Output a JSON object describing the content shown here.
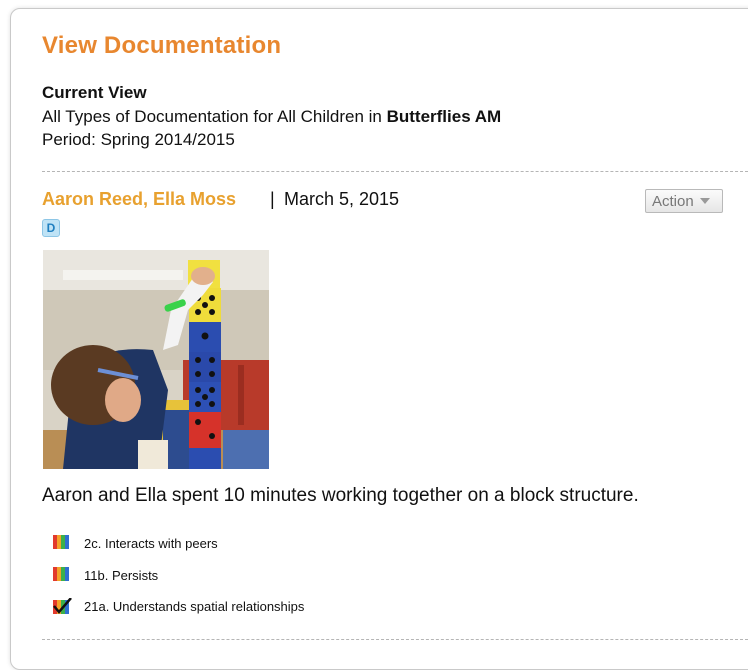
{
  "header": {
    "title": "View Documentation"
  },
  "current_view": {
    "heading": "Current View",
    "description_prefix": "All Types of Documentation for All Children in",
    "classroom": "Butterflies AM",
    "period": "Period: Spring 2014/2015"
  },
  "entry": {
    "children": "Aaron Reed, Ella Moss",
    "separator": "|",
    "date": "March 5, 2015",
    "action_label": "Action",
    "type_badge": "D",
    "caption": "Aaron and Ella spent 10 minutes working together on a block structure.",
    "standards": [
      {
        "label": "2c. Interacts with peers",
        "icon": "rainbow-bars-icon"
      },
      {
        "label": "11b. Persists",
        "icon": "rainbow-bars-icon"
      },
      {
        "label": "21a. Understands spatial relationships",
        "icon": "rainbow-check-icon"
      }
    ]
  },
  "colors": {
    "title": "#e8872f",
    "names": "#e8a12f",
    "badge": "#1f7fc0"
  }
}
